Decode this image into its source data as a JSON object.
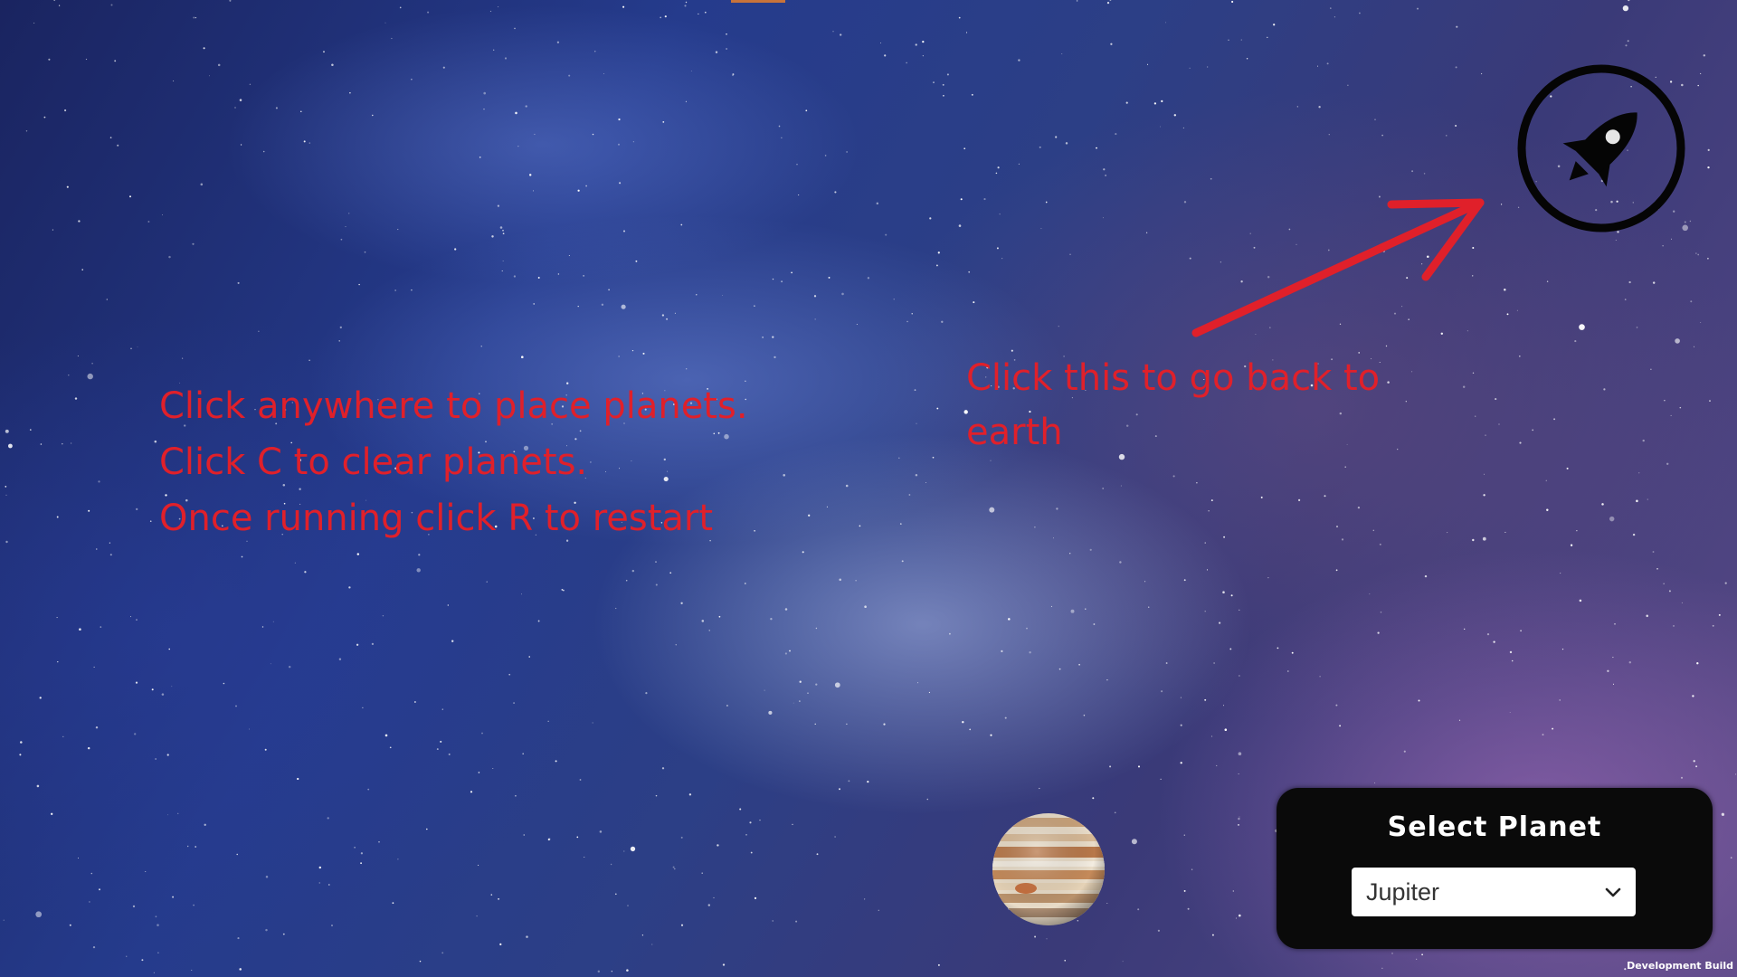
{
  "instructions": {
    "lines": [
      "Click anywhere to place planets.",
      "Click C to clear planets.",
      "Once running click R to restart"
    ]
  },
  "hint": {
    "text": "Click this to go back to earth"
  },
  "back_button": {
    "icon": "rocket-icon"
  },
  "planet_selector": {
    "title": "Select Planet",
    "selected": "Jupiter",
    "chevron_icon": "chevron-down-icon"
  },
  "preview": {
    "icon": "jupiter-planet-icon"
  },
  "footer": {
    "build_label": "Development Build"
  },
  "colors": {
    "annotation": "#e0202a",
    "panel": "#0a0a0a",
    "dropdown": "#ffffff"
  }
}
